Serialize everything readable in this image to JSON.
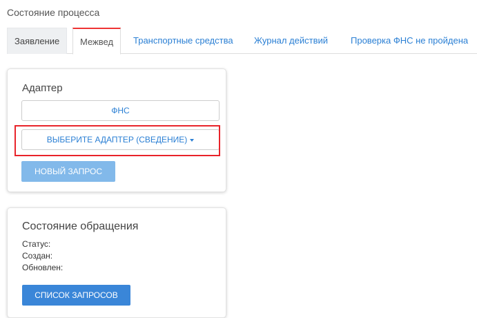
{
  "page": {
    "section_title": "Состояние процесса"
  },
  "tabs": [
    {
      "label": "Заявление"
    },
    {
      "label": "Межвед"
    },
    {
      "label": "Транспортные средства"
    },
    {
      "label": "Журнал действий"
    },
    {
      "label": "Проверка ФНС не пройдена"
    }
  ],
  "adapter_panel": {
    "title": "Адаптер",
    "fns_button": "ФНС",
    "select_adapter_button": "ВЫБЕРИТЕ АДАПТЕР (СВЕДЕНИЕ)",
    "new_request_button": "НОВЫЙ ЗАПРОС"
  },
  "status_panel": {
    "title": "Состояние обращения",
    "status_label": "Статус:",
    "created_label": "Создан:",
    "updated_label": "Обновлен:",
    "requests_list_button": "СПИСОК ЗАПРОСОВ"
  },
  "colors": {
    "link": "#2a7fd4",
    "active_tab_border": "#e33",
    "highlight": "#e8232a",
    "primary_button": "#3a86d8",
    "disabled_button": "#82b9ea"
  }
}
